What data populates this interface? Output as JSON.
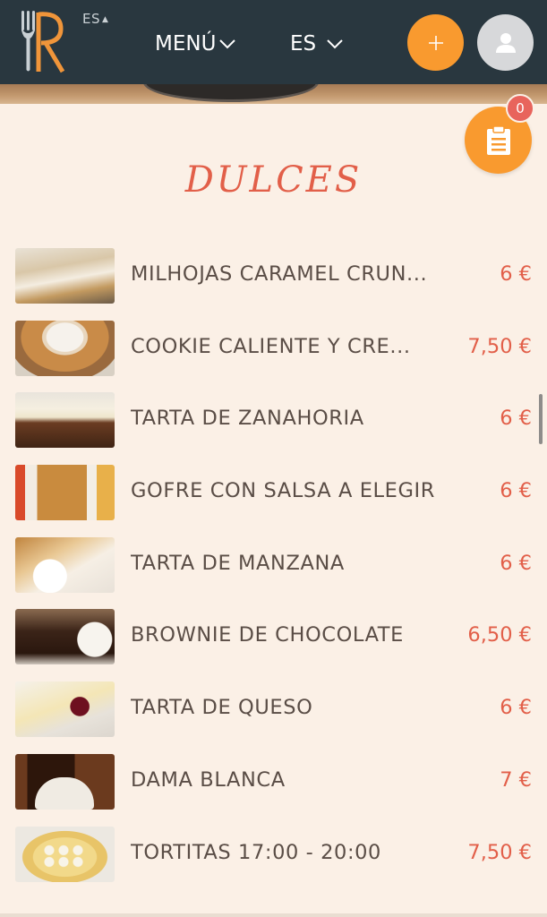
{
  "header": {
    "lang_mini": "ES",
    "menu_label": "MENÚ",
    "lang_label": "ES",
    "add_icon": "plus-icon",
    "user_icon": "user-icon",
    "brand_color": "#29373f",
    "accent_color": "#f99a2f"
  },
  "orders": {
    "badge_count": "0",
    "icon": "clipboard-icon"
  },
  "section": {
    "title": "DULCES",
    "title_color": "#e25f49"
  },
  "items": [
    {
      "name": "MILHOJAS CARAMEL CRUN...",
      "price": "6 €"
    },
    {
      "name": "COOKIE CALIENTE Y CRE...",
      "price": "7,50 €"
    },
    {
      "name": "TARTA DE ZANAHORIA",
      "price": "6 €"
    },
    {
      "name": "GOFRE CON SALSA A ELEGIR",
      "price": "6 €"
    },
    {
      "name": "TARTA DE MANZANA",
      "price": "6 €"
    },
    {
      "name": "BROWNIE DE CHOCOLATE",
      "price": "6,50 €"
    },
    {
      "name": "TARTA DE QUESO",
      "price": "6 €"
    },
    {
      "name": "DAMA BLANCA",
      "price": "7 €"
    },
    {
      "name": "TORTITAS 17:00 - 20:00",
      "price": "7,50 €"
    }
  ]
}
